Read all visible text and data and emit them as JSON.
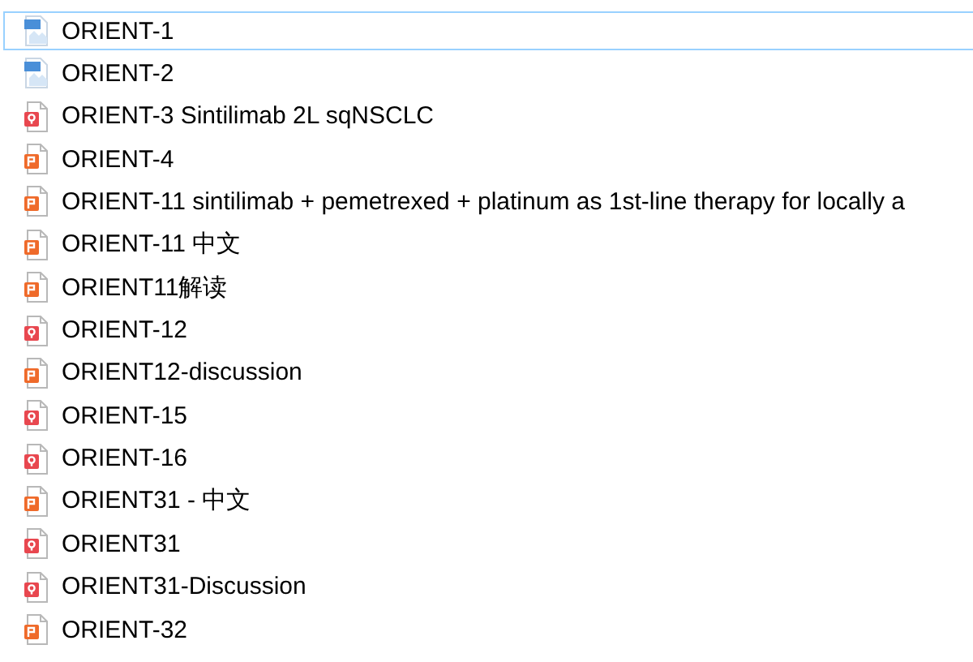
{
  "files": [
    {
      "name": "ORIENT-1",
      "kind": "image",
      "selected": true
    },
    {
      "name": "ORIENT-2",
      "kind": "image",
      "selected": false
    },
    {
      "name": "ORIENT-3 Sintilimab 2L sqNSCLC",
      "kind": "pdf",
      "selected": false
    },
    {
      "name": "ORIENT-4",
      "kind": "slides",
      "selected": false
    },
    {
      "name": "ORIENT-11 sintilimab + pemetrexed + platinum as 1st-line therapy for locally a",
      "kind": "slides",
      "selected": false
    },
    {
      "name": "ORIENT-11 中文",
      "kind": "slides",
      "selected": false
    },
    {
      "name": "ORIENT11解读",
      "kind": "slides",
      "selected": false
    },
    {
      "name": "ORIENT-12",
      "kind": "pdf",
      "selected": false
    },
    {
      "name": "ORIENT12-discussion",
      "kind": "slides",
      "selected": false
    },
    {
      "name": "ORIENT-15",
      "kind": "pdf",
      "selected": false
    },
    {
      "name": "ORIENT-16",
      "kind": "pdf",
      "selected": false
    },
    {
      "name": "ORIENT31 - 中文",
      "kind": "slides",
      "selected": false
    },
    {
      "name": "ORIENT31",
      "kind": "pdf",
      "selected": false
    },
    {
      "name": "ORIENT31-Discussion",
      "kind": "pdf",
      "selected": false
    },
    {
      "name": "ORIENT-32",
      "kind": "slides",
      "selected": false
    }
  ]
}
